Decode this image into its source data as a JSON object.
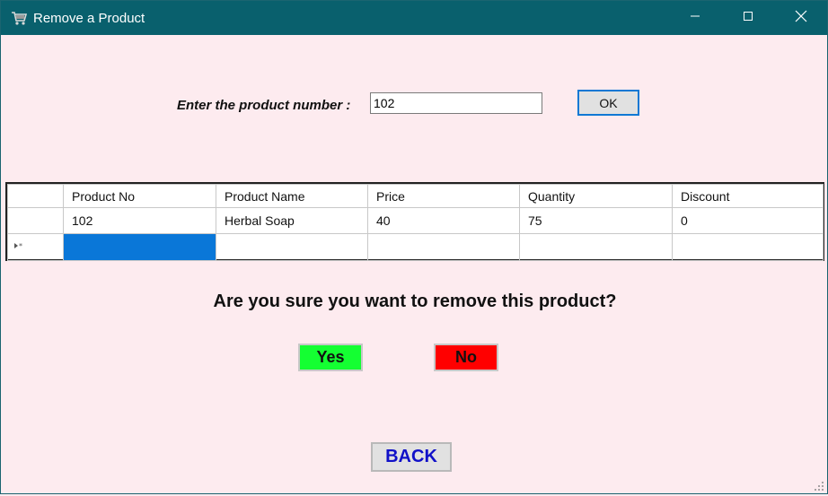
{
  "window": {
    "title": "Remove a Product",
    "app_icon": "cart-icon",
    "controls": {
      "minimize": "minimize-icon",
      "maximize": "maximize-icon",
      "close": "close-icon"
    }
  },
  "form": {
    "prompt_label": "Enter the product number :",
    "product_number_value": "102",
    "ok_label": "OK"
  },
  "grid": {
    "columns": [
      "Product No",
      "Product Name",
      "Price",
      "Quantity",
      "Discount"
    ],
    "rows": [
      [
        "102",
        "Herbal Soap",
        "40",
        "75",
        "0"
      ]
    ],
    "new_row_marker_icon": "new-row-marker-icon"
  },
  "confirm": {
    "question": "Are you sure you want to remove this product?",
    "yes_label": "Yes",
    "no_label": "No",
    "yes_color": "#14ff32",
    "no_color": "#ff0000"
  },
  "back_label": "BACK",
  "colors": {
    "titlebar": "#09606d",
    "background": "#fdebef",
    "selection": "#0a77d8",
    "back_text": "#1010c8"
  }
}
